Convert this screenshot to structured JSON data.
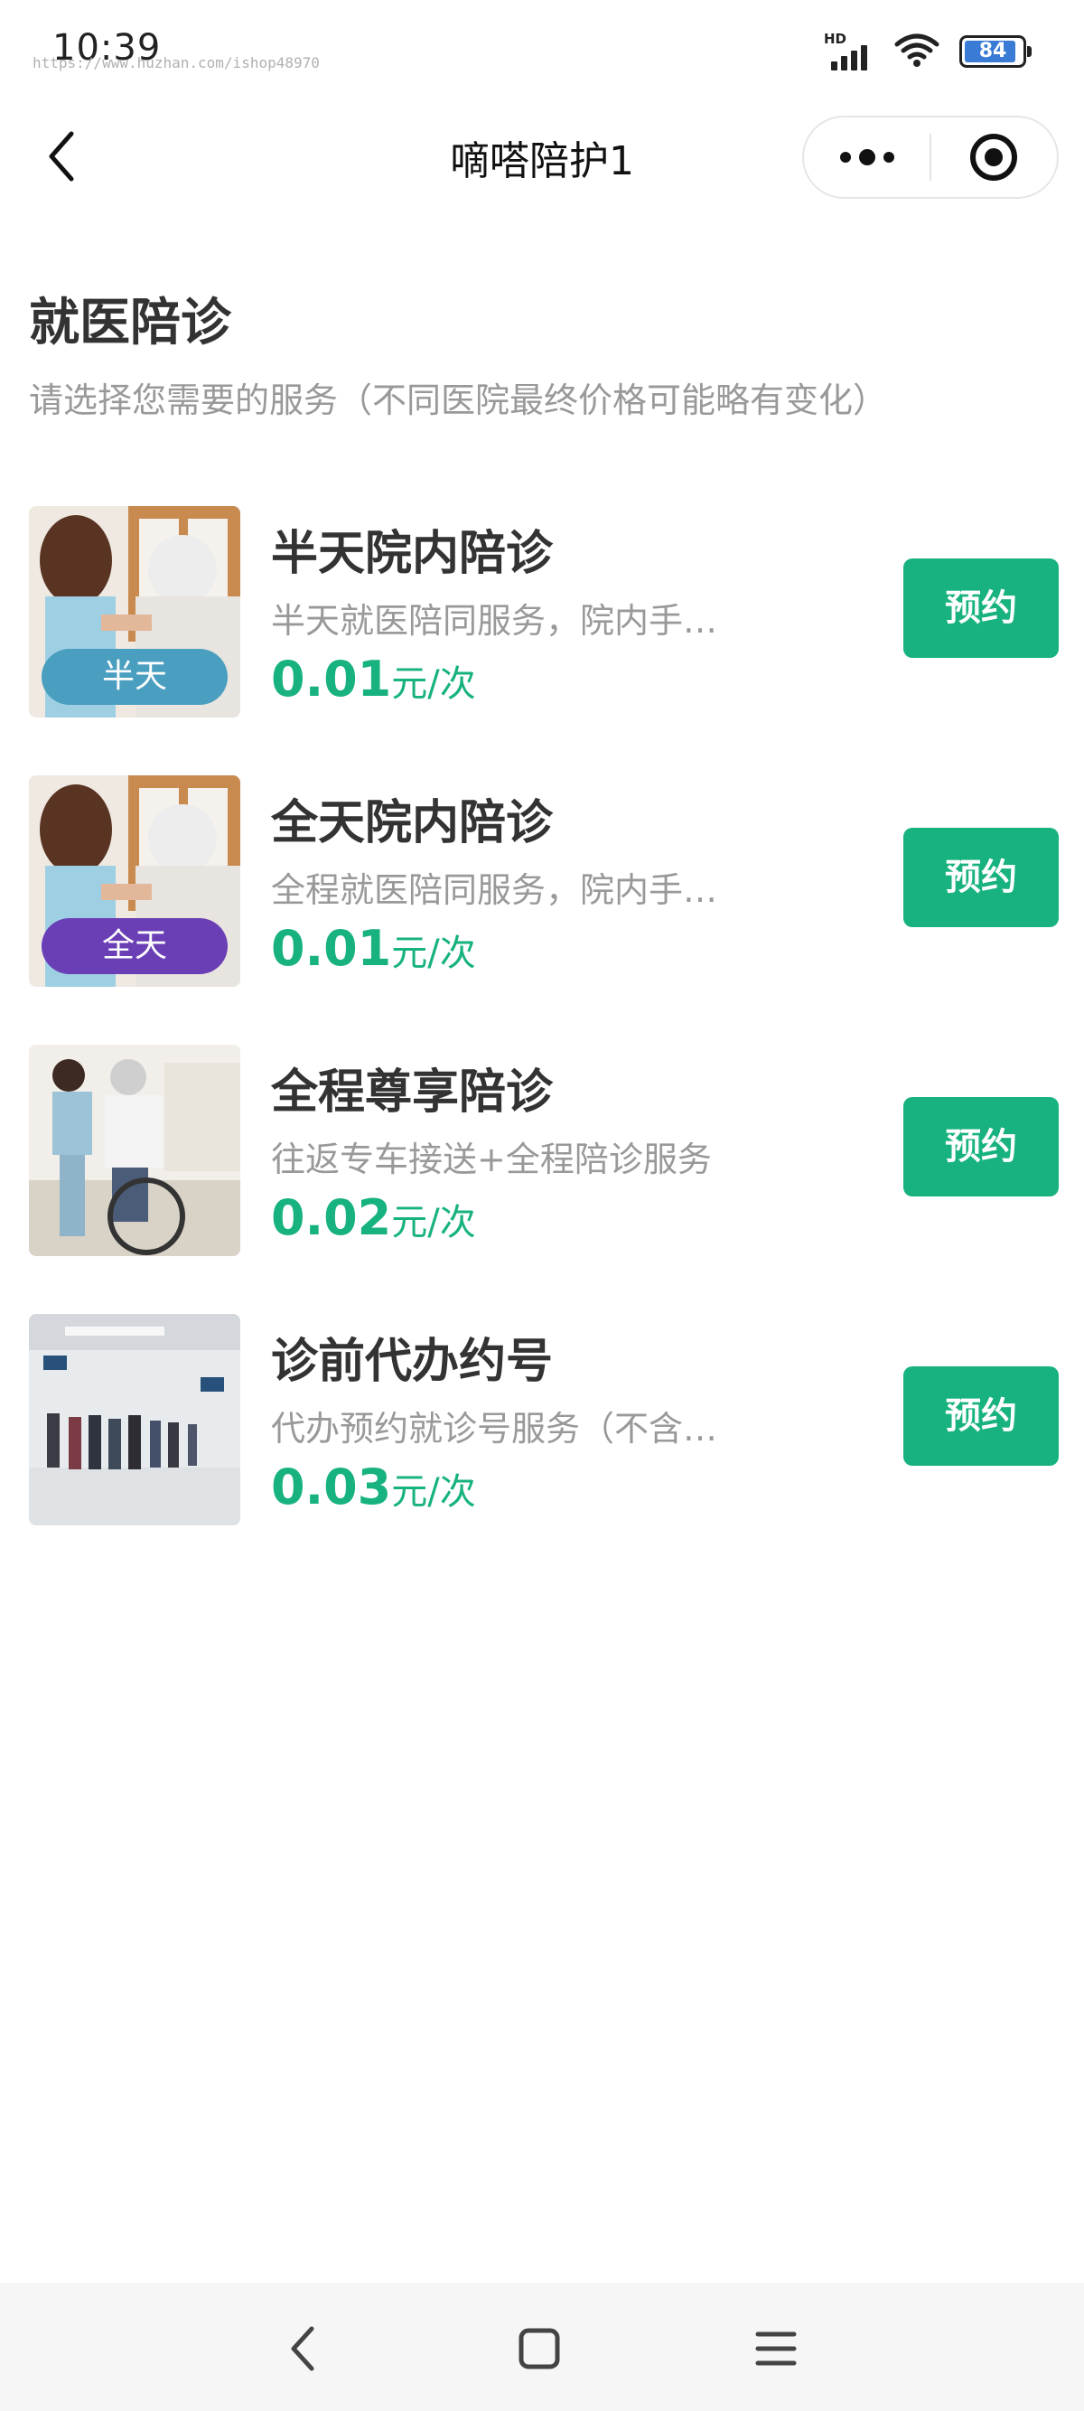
{
  "status_bar": {
    "time": "10:39",
    "watermark": "https://www.huzhan.com/ishop48970",
    "network_label": "HD",
    "battery_level": "84"
  },
  "nav": {
    "title": "嘀嗒陪护1",
    "icons": {
      "back": "chevron-left-icon",
      "more": "more-dots-icon",
      "close": "target-circle-icon"
    }
  },
  "section": {
    "title": "就医陪诊",
    "subtitle": "请选择您需要的服务（不同医院最终价格可能略有变化）"
  },
  "services": [
    {
      "name": "半天院内陪诊",
      "desc": "半天就医陪同服务，院内手…",
      "price": "0.01",
      "unit": "元/次",
      "tag": "半天",
      "tag_color": "#4a9ec0",
      "button": "预约"
    },
    {
      "name": "全天院内陪诊",
      "desc": "全程就医陪同服务，院内手…",
      "price": "0.01",
      "unit": "元/次",
      "tag": "全天",
      "tag_color": "#6a3fb5",
      "button": "预约"
    },
    {
      "name": "全程尊享陪诊",
      "desc": "往返专车接送+全程陪诊服务",
      "price": "0.02",
      "unit": "元/次",
      "tag": "",
      "button": "预约"
    },
    {
      "name": "诊前代办约号",
      "desc": "代办预约就诊号服务（不含…",
      "price": "0.03",
      "unit": "元/次",
      "tag": "",
      "button": "预约"
    }
  ],
  "colors": {
    "accent": "#17b27f",
    "text": "#333333",
    "muted": "#999999"
  },
  "system_nav": {
    "icons": [
      "back-triangle-icon",
      "home-square-icon",
      "menu-lines-icon"
    ]
  }
}
